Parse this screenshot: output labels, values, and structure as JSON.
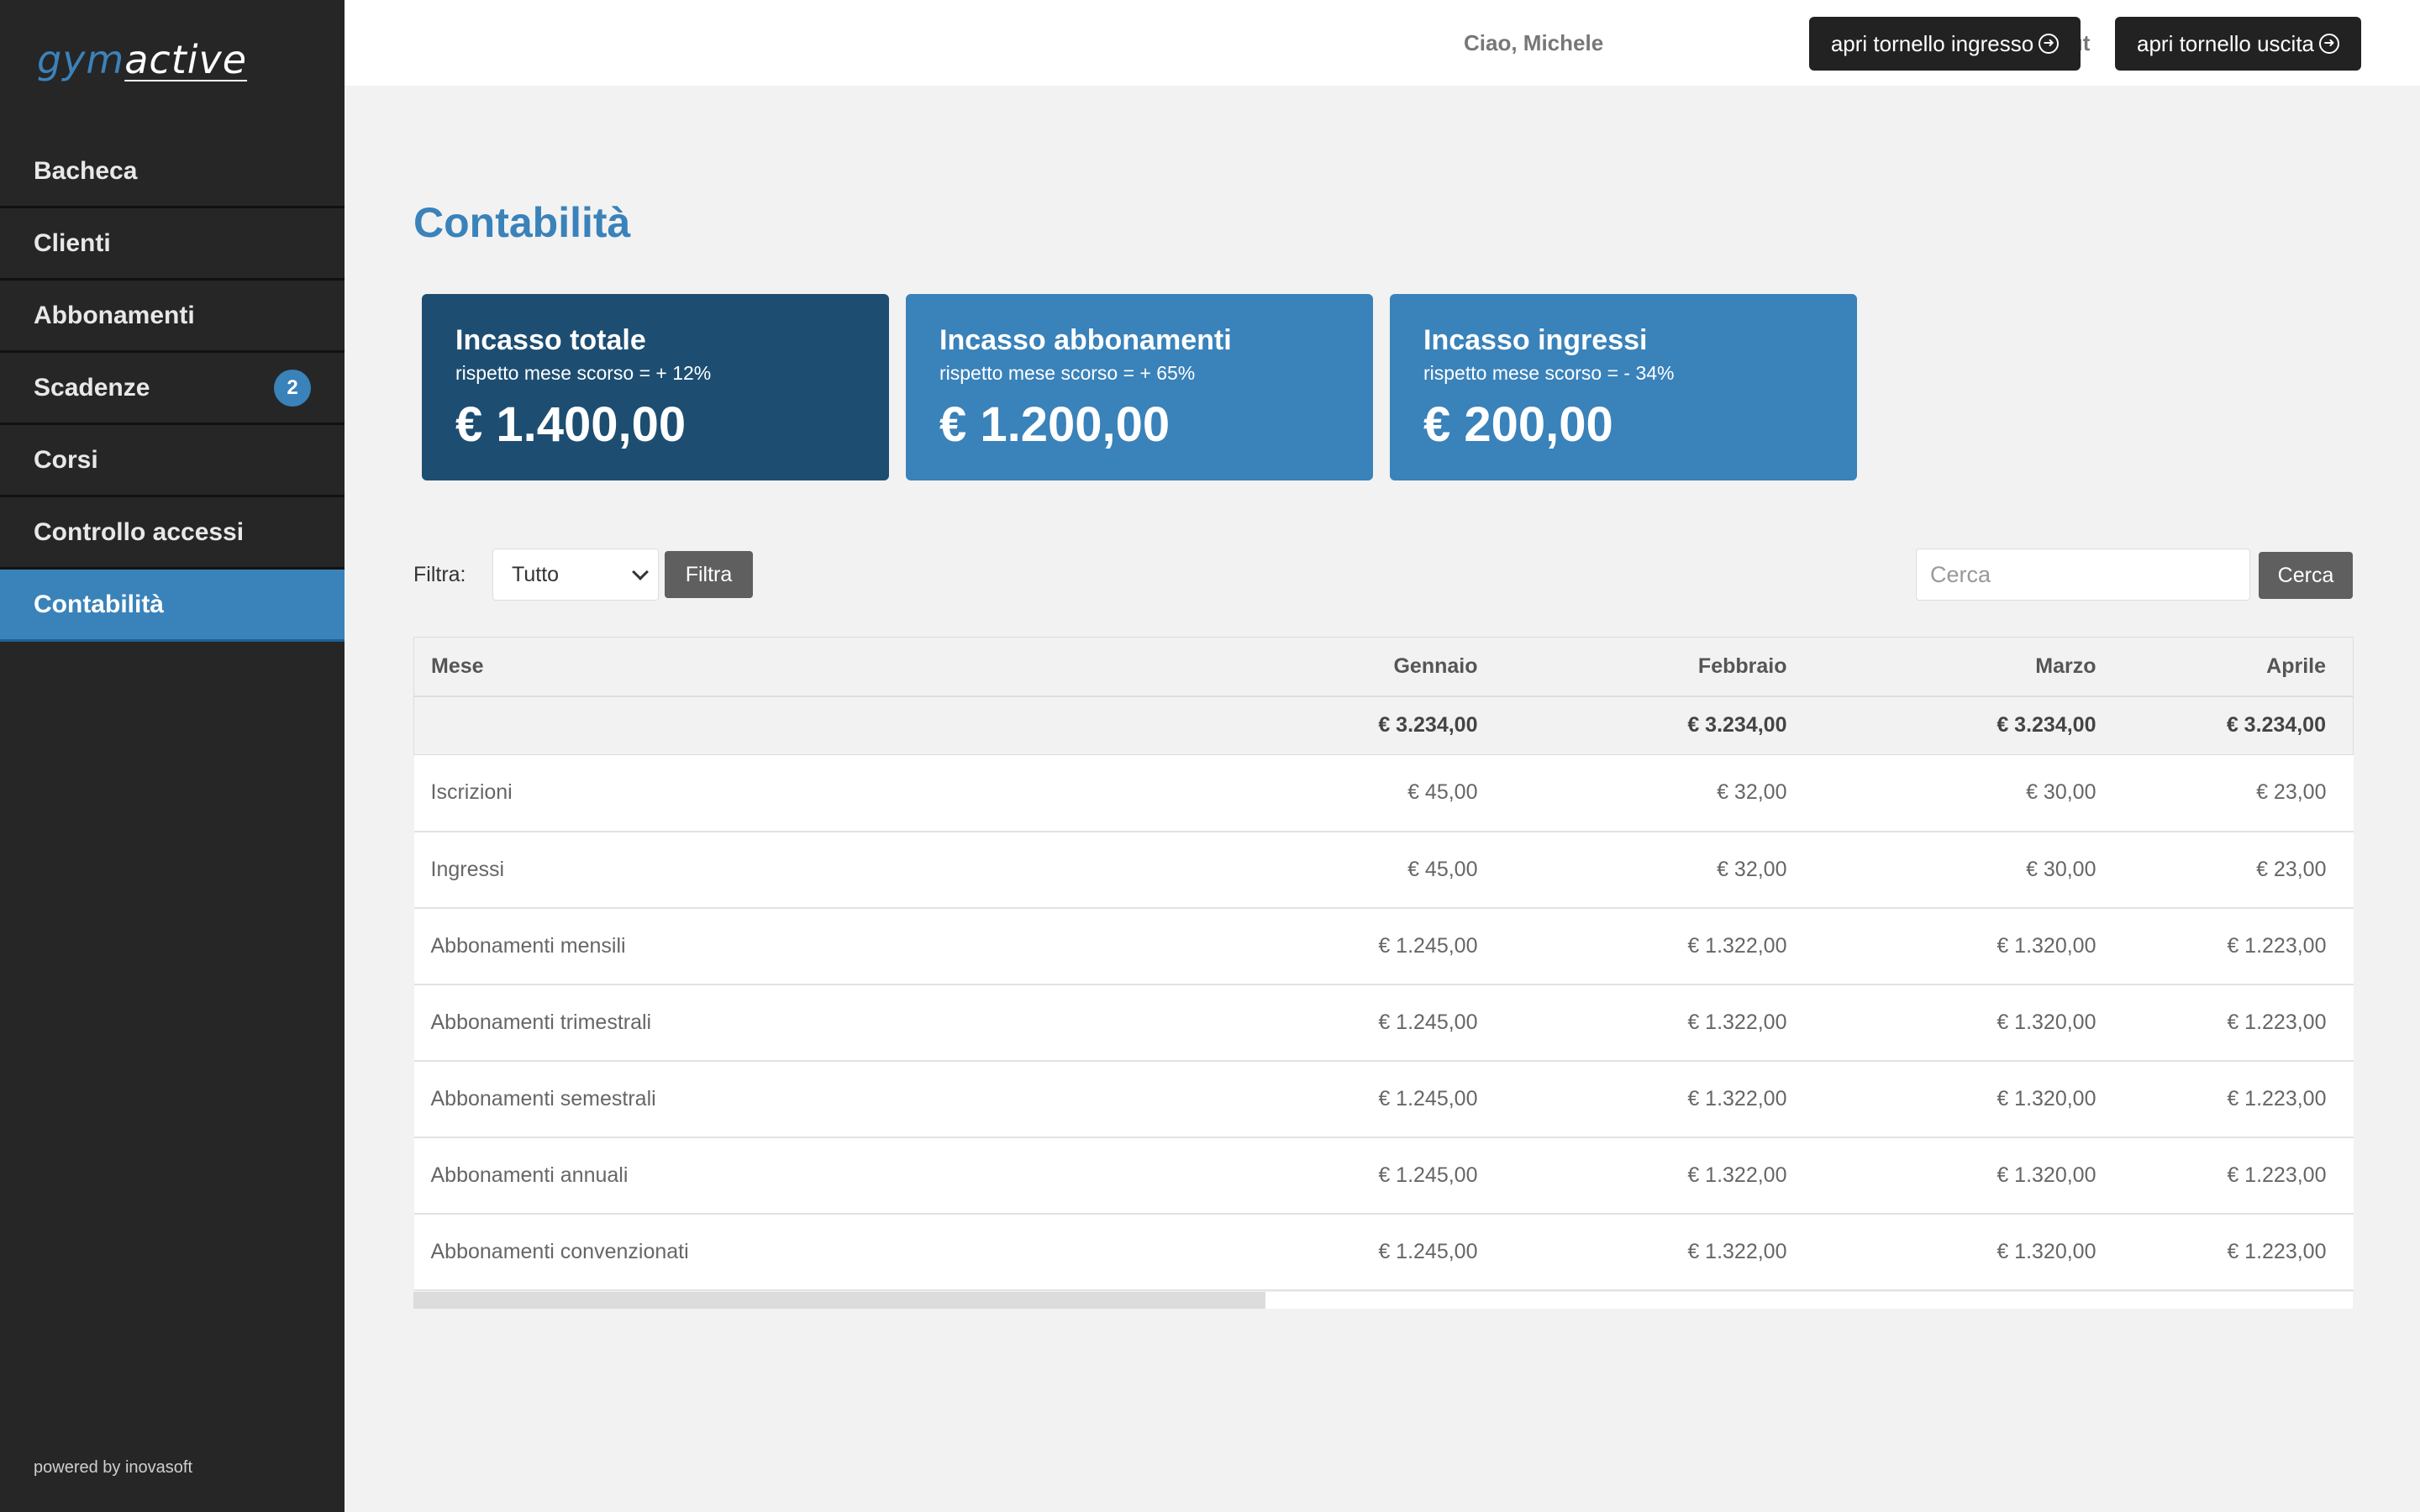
{
  "sidebar": {
    "logo_part1": "gym",
    "logo_part2": "active",
    "items": [
      {
        "label": "Bacheca"
      },
      {
        "label": "Clienti"
      },
      {
        "label": "Abbonamenti"
      },
      {
        "label": "Scadenze",
        "badge": "2"
      },
      {
        "label": "Corsi"
      },
      {
        "label": "Controllo accessi"
      },
      {
        "label": "Contabilità",
        "active": true
      }
    ],
    "footer": "powered by inovasoft"
  },
  "header": {
    "greeting": "Ciao, Michele",
    "logout_label": "logout",
    "btn_entry": "apri tornello ingresso",
    "btn_exit": "apri tornello uscita"
  },
  "page": {
    "title": "Contabilità"
  },
  "cards": [
    {
      "title": "Incasso totale",
      "subtitle": "rispetto mese scorso = + 12%",
      "amount": "€ 1.400,00"
    },
    {
      "title": "Incasso abbonamenti",
      "subtitle": "rispetto mese scorso = + 65%",
      "amount": "€ 1.200,00"
    },
    {
      "title": "Incasso ingressi",
      "subtitle": "rispetto mese scorso = - 34%",
      "amount": "€ 200,00"
    }
  ],
  "filter": {
    "label": "Filtra:",
    "selected": "Tutto",
    "button": "Filtra"
  },
  "search": {
    "placeholder": "Cerca",
    "button": "Cerca"
  },
  "table": {
    "headers": [
      "Mese",
      "Gennaio",
      "Febbraio",
      "Marzo",
      "Aprile"
    ],
    "totals": [
      "",
      "€ 3.234,00",
      "€ 3.234,00",
      "€ 3.234,00",
      "€ 3.234,00"
    ],
    "rows": [
      [
        "Iscrizioni",
        "€ 45,00",
        "€ 32,00",
        "€ 30,00",
        "€ 23,00"
      ],
      [
        "Ingressi",
        "€ 45,00",
        "€ 32,00",
        "€ 30,00",
        "€ 23,00"
      ],
      [
        "Abbonamenti mensili",
        "€ 1.245,00",
        "€ 1.322,00",
        "€ 1.320,00",
        "€ 1.223,00"
      ],
      [
        "Abbonamenti trimestrali",
        "€ 1.245,00",
        "€ 1.322,00",
        "€ 1.320,00",
        "€ 1.223,00"
      ],
      [
        "Abbonamenti semestrali",
        "€ 1.245,00",
        "€ 1.322,00",
        "€ 1.320,00",
        "€ 1.223,00"
      ],
      [
        "Abbonamenti annuali",
        "€ 1.245,00",
        "€ 1.322,00",
        "€ 1.320,00",
        "€ 1.223,00"
      ],
      [
        "Abbonamenti convenzionati",
        "€ 1.245,00",
        "€ 1.322,00",
        "€ 1.320,00",
        "€ 1.223,00"
      ]
    ]
  }
}
